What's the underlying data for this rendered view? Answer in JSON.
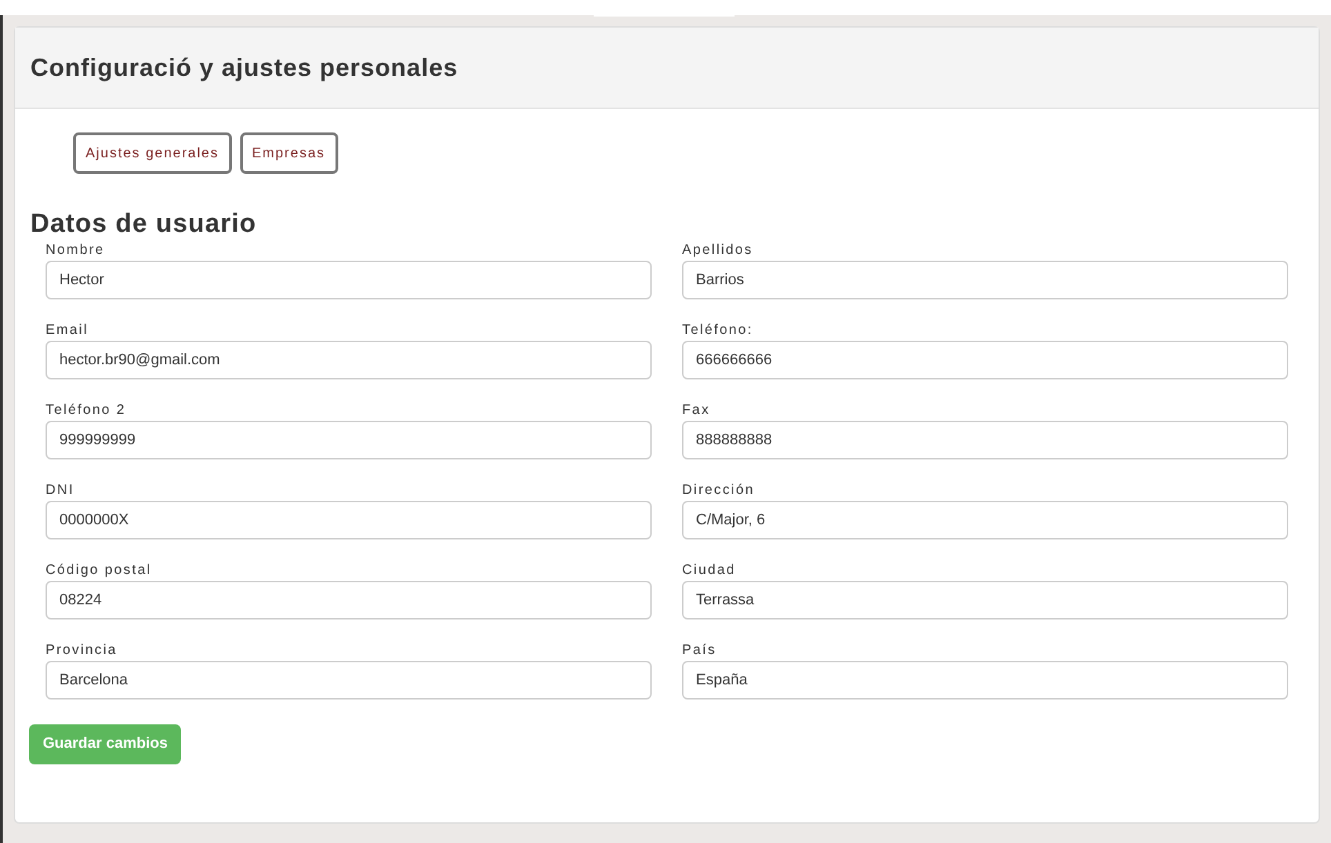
{
  "panel": {
    "title": "Configuració y ajustes personales"
  },
  "tabs": [
    {
      "label": "Ajustes generales"
    },
    {
      "label": "Empresas"
    }
  ],
  "section": {
    "title": "Datos de usuario"
  },
  "fields": [
    {
      "label": "Nombre",
      "value": "Hector"
    },
    {
      "label": "Apellidos",
      "value": "Barrios"
    },
    {
      "label": "Email",
      "value": "hector.br90@gmail.com"
    },
    {
      "label": "Teléfono:",
      "value": "666666666"
    },
    {
      "label": "Teléfono 2",
      "value": "999999999"
    },
    {
      "label": "Fax",
      "value": "888888888"
    },
    {
      "label": "DNI",
      "value": "0000000X"
    },
    {
      "label": "Dirección",
      "value": "C/Major, 6"
    },
    {
      "label": "Código postal",
      "value": "08224"
    },
    {
      "label": "Ciudad",
      "value": "Terrassa"
    },
    {
      "label": "Provincia",
      "value": "Barcelona"
    },
    {
      "label": "País",
      "value": "España"
    }
  ],
  "save_button": "Guardar cambios"
}
